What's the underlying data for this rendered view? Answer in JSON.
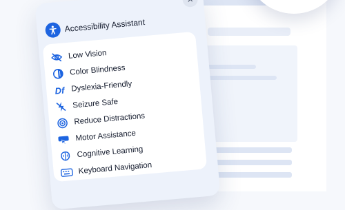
{
  "panel": {
    "title": "Accessibility Assistant",
    "close_label": "×",
    "accent_color": "#1d64e0",
    "items": [
      {
        "label": "Low Vision",
        "icon": "eye-slash-icon"
      },
      {
        "label": "Color Blindness",
        "icon": "contrast-icon"
      },
      {
        "label": "Dyslexia-Friendly",
        "icon": "df-text-icon",
        "icon_text": "Df"
      },
      {
        "label": "Seizure Safe",
        "icon": "lightning-slash-icon"
      },
      {
        "label": "Reduce Distractions",
        "icon": "target-icon"
      },
      {
        "label": "Motor Assistance",
        "icon": "cursor-icon"
      },
      {
        "label": "Cognitive Learning",
        "icon": "brain-icon"
      },
      {
        "label": "Keyboard Navigation",
        "icon": "keyboard-icon"
      }
    ]
  }
}
